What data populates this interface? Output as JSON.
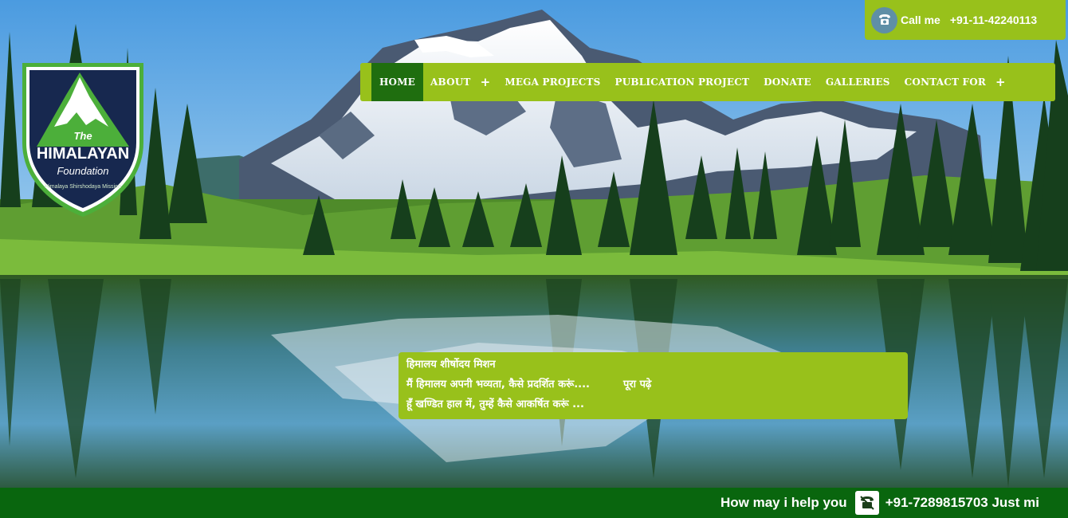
{
  "colors": {
    "accent_green": "#98c11b",
    "active_nav": "#1f6e0f",
    "bottom_bar": "#09660e",
    "logo_navy": "#17284f"
  },
  "logo": {
    "line1": "The",
    "line2": "HIMALAYAN",
    "line3": "Foundation",
    "arc_text": "Himalaya Shirshodaya Mission"
  },
  "call": {
    "icon": "phone-icon",
    "label": "Call me",
    "number": "+91-11-42240113"
  },
  "nav": {
    "items": [
      {
        "label": "HOME",
        "active": true
      },
      {
        "label": "ABOUT",
        "has_submenu": true
      },
      {
        "label": "MEGA PROJECTS"
      },
      {
        "label": "PUBLICATION PROJECT"
      },
      {
        "label": "DONATE"
      },
      {
        "label": "GALLERIES"
      },
      {
        "label": "CONTACT FOR",
        "has_submenu": true
      }
    ],
    "plus": "+"
  },
  "quote": {
    "title": "हिमालय शीर्षोदय मिशन",
    "line1": "मैं हिमालय अपनी भव्यता, कैसे प्रदर्शित करूं....",
    "read_more": "पूरा पढ़े",
    "line2": "हूँ खण्डित हाल में, तुम्हें कैसे आकर्षित करूं ..."
  },
  "ticker": {
    "help_text": "How may i help you",
    "icon": "telephone-icon",
    "contact": "+91-7289815703 Just mi"
  }
}
